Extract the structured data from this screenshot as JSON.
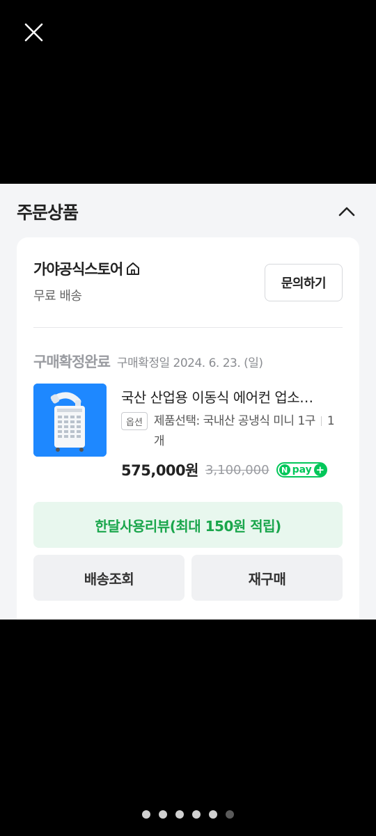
{
  "section": {
    "title": "주문상품"
  },
  "store": {
    "name": "가야공식스토어",
    "shipping": "무료 배송",
    "inquiry_label": "문의하기"
  },
  "order": {
    "status": "구매확정완료",
    "status_date": "구매확정일 2024. 6. 23. (일)"
  },
  "product": {
    "title": "국산 산업용 이동식 에어컨 업소…",
    "option_badge": "옵션",
    "option_text": "제품선택: 국내산 공냉식 미니 1구",
    "quantity": "1개",
    "price": "575,000원",
    "original_price": "3,100,000",
    "npay_label": "pay"
  },
  "actions": {
    "review": "한달사용리뷰(최대 150원 적립)",
    "track": "배송조회",
    "rebuy": "재구매"
  },
  "pager": {
    "count": 6,
    "active_index": 5
  },
  "icons": {
    "close": "close-icon",
    "collapse": "chevron-up-icon",
    "home": "home-icon"
  },
  "colors": {
    "accent_green": "#03c75a",
    "review_text": "#1aa64c",
    "review_bg": "#e8f7ee"
  }
}
